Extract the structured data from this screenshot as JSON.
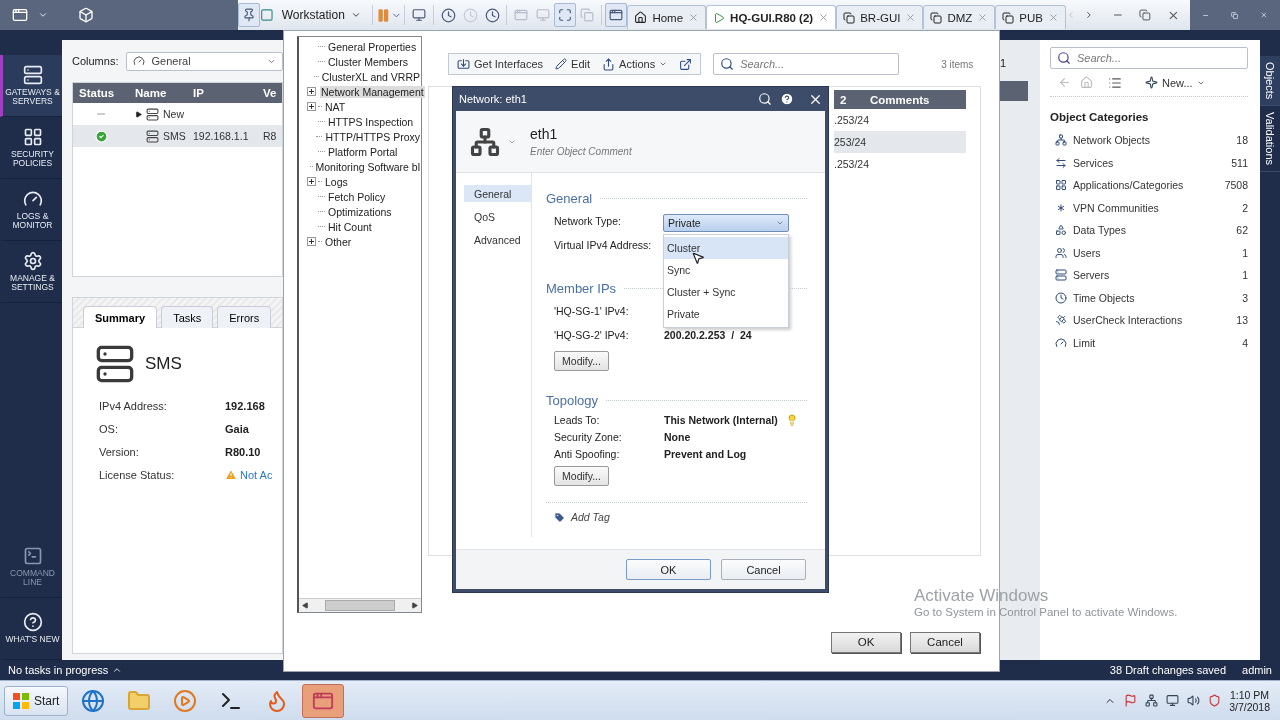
{
  "vm": {
    "product": "Workstation",
    "tabs": [
      {
        "label": "Home",
        "selected": false
      },
      {
        "label": "HQ-GUI.R80 (2)",
        "selected": true
      },
      {
        "label": "BR-GUI",
        "selected": false
      },
      {
        "label": "DMZ",
        "selected": false
      },
      {
        "label": "PUB",
        "selected": false
      }
    ]
  },
  "nav": [
    {
      "label": "GATEWAYS & SERVERS",
      "selected": true,
      "disabled": false,
      "kind": "main"
    },
    {
      "label": "SECURITY POLICIES",
      "selected": false,
      "disabled": false,
      "kind": "main"
    },
    {
      "label": "LOGS & MONITOR",
      "selected": false,
      "disabled": false,
      "kind": "main"
    },
    {
      "label": "MANAGE & SETTINGS",
      "selected": false,
      "disabled": false,
      "kind": "main"
    },
    {
      "label": "COMMAND LINE",
      "selected": false,
      "disabled": true,
      "kind": "bottom"
    },
    {
      "label": "WHAT'S NEW",
      "selected": false,
      "disabled": false,
      "kind": "bottom"
    }
  ],
  "gateways": {
    "columns_label": "Columns:",
    "columns_value": "General",
    "columns": [
      "Status",
      "Name",
      "IP",
      "Ve"
    ],
    "rows": [
      {
        "kind": "pending",
        "name": "New",
        "expandable": true,
        "selected": false
      },
      {
        "kind": "ok",
        "name": "SMS",
        "ip": "192.168.1.1",
        "version": "R8",
        "expandable": false,
        "selected": true
      }
    ]
  },
  "summary": {
    "tabs": [
      {
        "label": "Summary",
        "selected": true
      },
      {
        "label": "Tasks",
        "selected": false
      },
      {
        "label": "Errors",
        "selected": false
      }
    ],
    "title": "SMS",
    "fields": [
      {
        "label": "IPv4 Address:",
        "value": "192.168",
        "kind": "text"
      },
      {
        "label": "OS:",
        "value": "Gaia",
        "kind": "text"
      },
      {
        "label": "Version:",
        "value": "R80.10",
        "kind": "text"
      },
      {
        "label": "License Status:",
        "value": "Not Ac",
        "kind": "warning"
      }
    ]
  },
  "background_table": {
    "count": "1"
  },
  "gateway_window": {
    "tree": [
      {
        "label": "General Properties",
        "expandable": false,
        "selected": false
      },
      {
        "label": "Cluster Members",
        "expandable": false,
        "selected": false
      },
      {
        "label": "ClusterXL and VRRP",
        "expandable": false,
        "selected": false
      },
      {
        "label": "Network Management",
        "expandable": true,
        "selected": true
      },
      {
        "label": "NAT",
        "expandable": true,
        "selected": false
      },
      {
        "label": "HTTPS Inspection",
        "expandable": false,
        "selected": false
      },
      {
        "label": "HTTP/HTTPS Proxy",
        "expandable": false,
        "selected": false
      },
      {
        "label": "Platform Portal",
        "expandable": false,
        "selected": false
      },
      {
        "label": "Monitoring Software bl",
        "expandable": false,
        "selected": false
      },
      {
        "label": "Logs",
        "expandable": true,
        "selected": false
      },
      {
        "label": "Fetch Policy",
        "expandable": false,
        "selected": false
      },
      {
        "label": "Optimizations",
        "expandable": false,
        "selected": false
      },
      {
        "label": "Hit Count",
        "expandable": false,
        "selected": false
      },
      {
        "label": "Other",
        "expandable": true,
        "selected": false
      }
    ],
    "toolbar": [
      {
        "label": "Get Interfaces",
        "kind": "action"
      },
      {
        "label": "Edit",
        "kind": "action"
      },
      {
        "label": "Actions",
        "kind": "menu"
      }
    ],
    "search": {
      "placeholder": "Search..."
    },
    "item_count": "3 items",
    "table": {
      "columns": [
        "2",
        "Comments"
      ],
      "rows": [
        {
          "column_1": ".253/24",
          "selected": false
        },
        {
          "column_1": "253/24",
          "selected": true
        },
        {
          "column_1": ".253/24",
          "selected": false
        }
      ]
    },
    "buttons": [
      "OK",
      "Cancel"
    ]
  },
  "dialog": {
    "title": "Network: eth1",
    "name": "eth1",
    "comment": {
      "placeholder": "Enter Object Comment"
    },
    "tabs": [
      {
        "label": "General",
        "selected": true
      },
      {
        "label": "QoS",
        "selected": false
      },
      {
        "label": "Advanced",
        "selected": false
      }
    ],
    "general": {
      "heading": "General",
      "network_type_label": "Network Type:",
      "network_type": "Private",
      "virtual_ip_label": "Virtual IPv4 Address:",
      "dropdown": {
        "open": true,
        "options": [
          {
            "label": "Cluster",
            "hovered": true
          },
          {
            "label": "Sync",
            "hovered": false
          },
          {
            "label": "Cluster + Sync",
            "hovered": false
          },
          {
            "label": "Private",
            "hovered": false
          }
        ]
      }
    },
    "members": {
      "heading": "Member IPs",
      "rows": [
        {
          "label": "'HQ-SG-1' IPv4:"
        },
        {
          "label": "'HQ-SG-2' IPv4:",
          "value": "200.20.2.253  /  24"
        }
      ],
      "button": "Modify..."
    },
    "topology": {
      "heading": "Topology",
      "rows": [
        {
          "label": "Leads To:",
          "value": "This Network (Internal)",
          "hint": true
        },
        {
          "label": "Security Zone:",
          "value": "None",
          "hint": false
        },
        {
          "label": "Anti Spoofing:",
          "value": "Prevent and Log",
          "hint": false
        }
      ],
      "button": "Modify..."
    },
    "add_tag": "Add Tag",
    "buttons": [
      "OK",
      "Cancel"
    ]
  },
  "objects_panel": {
    "search": {
      "placeholder": "Search..."
    },
    "new_label": "New...",
    "heading": "Object Categories",
    "categories": [
      {
        "name": "Network Objects",
        "count": "18"
      },
      {
        "name": "Services",
        "count": "511"
      },
      {
        "name": "Applications/Categories",
        "count": "7508"
      },
      {
        "name": "VPN Communities",
        "count": "2"
      },
      {
        "name": "Data Types",
        "count": "62"
      },
      {
        "name": "Users",
        "count": "1"
      },
      {
        "name": "Servers",
        "count": "1"
      },
      {
        "name": "Time Objects",
        "count": "3"
      },
      {
        "name": "UserCheck Interactions",
        "count": "13"
      },
      {
        "name": "Limit",
        "count": "4"
      }
    ],
    "side_tabs": [
      {
        "label": "Objects",
        "selected": true
      },
      {
        "label": "Validations",
        "selected": false
      }
    ]
  },
  "status_bar": {
    "tasks": "No tasks in progress",
    "changes": "38 Draft changes saved",
    "user": "admin"
  },
  "activation_notice": {
    "title": "Activate Windows",
    "text": "Go to System in Control Panel to activate Windows."
  },
  "taskbar": {
    "start": "Start",
    "time": "1:10 PM",
    "date": "3/7/2018"
  }
}
